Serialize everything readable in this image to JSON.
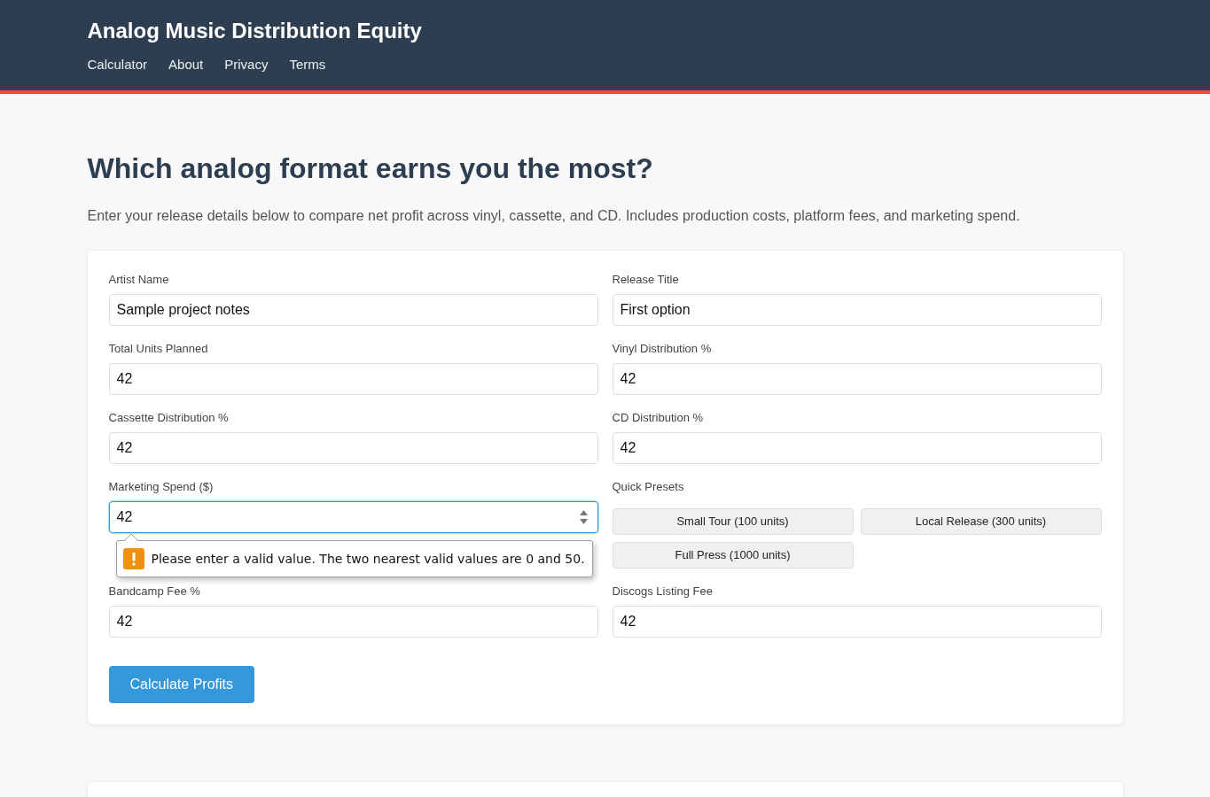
{
  "header": {
    "title": "Analog Music Distribution Equity",
    "nav": [
      {
        "label": "Calculator"
      },
      {
        "label": "About"
      },
      {
        "label": "Privacy"
      },
      {
        "label": "Terms"
      }
    ]
  },
  "intro": {
    "heading": "Which analog format earns you the most?",
    "description": "Enter your release details below to compare net profit across vinyl, cassette, and CD. Includes production costs, platform fees, and marketing spend."
  },
  "form": {
    "fields": [
      {
        "kind": "input",
        "label": "Artist Name",
        "value": "Sample project notes",
        "focused": false
      },
      {
        "kind": "input",
        "label": "Release Title",
        "value": "First option",
        "focused": false
      },
      {
        "kind": "input",
        "label": "Total Units Planned",
        "value": "42",
        "focused": false
      },
      {
        "kind": "input",
        "label": "Vinyl Distribution %",
        "value": "42",
        "focused": false
      },
      {
        "kind": "input",
        "label": "Cassette Distribution %",
        "value": "42",
        "focused": false
      },
      {
        "kind": "input",
        "label": "CD Distribution %",
        "value": "42",
        "focused": false
      },
      {
        "kind": "input",
        "label": "Marketing Spend ($)",
        "value": "42",
        "focused": true,
        "validation_message": "Please enter a valid value. The two nearest valid values are 0 and 50."
      },
      {
        "kind": "presets",
        "label": "Quick Presets",
        "buttons": [
          {
            "label": "Small Tour (100 units)"
          },
          {
            "label": "Local Release (300 units)"
          },
          {
            "label": "Full Press (1000 units)"
          }
        ]
      },
      {
        "kind": "input",
        "label": "Bandcamp Fee %",
        "value": "42",
        "focused": false
      },
      {
        "kind": "input",
        "label": "Discogs Listing Fee",
        "value": "42",
        "focused": false
      }
    ],
    "submit": "Calculate Profits"
  }
}
